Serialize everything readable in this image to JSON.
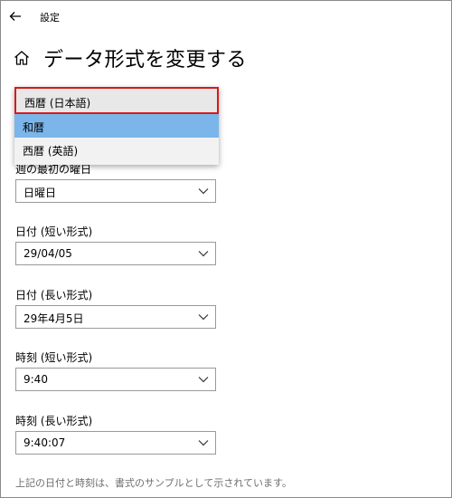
{
  "app": {
    "title": "設定"
  },
  "page": {
    "title": "データ形式を変更する"
  },
  "calendar": {
    "options": [
      "西暦 (日本語)",
      "和暦",
      "西暦 (英語)"
    ],
    "selected": "西暦 (日本語)",
    "highlighted": "和暦"
  },
  "first_day": {
    "label": "週の最初の曜日",
    "value": "日曜日"
  },
  "short_date": {
    "label": "日付 (短い形式)",
    "value": "29/04/05"
  },
  "long_date": {
    "label": "日付 (長い形式)",
    "value": "29年4月5日"
  },
  "short_time": {
    "label": "時刻 (短い形式)",
    "value": "9:40"
  },
  "long_time": {
    "label": "時刻 (長い形式)",
    "value": "9:40:07"
  },
  "footer": {
    "note": "上記の日付と時刻は、書式のサンプルとして示されています。"
  },
  "colors": {
    "highlight": "#7bb5ea",
    "focus_border": "#d81a1a",
    "text_secondary": "#6e6e6e"
  },
  "icons": {
    "back": "back-arrow-icon",
    "home": "home-icon",
    "chevron": "chevron-down-icon"
  }
}
